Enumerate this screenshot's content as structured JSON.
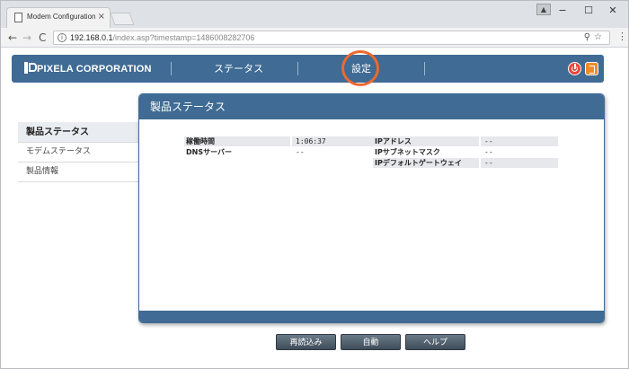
{
  "browser": {
    "tab_title": "Modem Configuration In",
    "tab_close": "×",
    "url_host": "192.168.0.1",
    "url_path": "/index.asp?timestamp=1486008282706",
    "nav_back": "←",
    "nav_forward": "→",
    "nav_reload": "C",
    "info": "i",
    "omni_icons": "⚲☆",
    "menu": "⋮",
    "minimize": "−",
    "maximize": "☐",
    "close": "✕",
    "profile": "▲"
  },
  "header": {
    "logo_text": "PIXELA CORPORATION",
    "nav_status": "ステータス",
    "nav_settings": "設定"
  },
  "sidebar": {
    "items": [
      {
        "label": "製品ステータス"
      },
      {
        "label": "モデムステータス"
      },
      {
        "label": "製品情報"
      }
    ]
  },
  "panel": {
    "title": "製品ステータス",
    "rows_left": [
      {
        "label": "稼働時間",
        "value": "1:06:37"
      },
      {
        "label": "DNSサーバー",
        "value": "--"
      }
    ],
    "rows_right": [
      {
        "label": "IPアドレス",
        "value": "--"
      },
      {
        "label": "IPサブネットマスク",
        "value": "--"
      },
      {
        "label": "IPデフォルトゲートウェイ",
        "value": "--"
      }
    ]
  },
  "buttons": {
    "reload": "再読込み",
    "auto": "自動",
    "help": "ヘルプ"
  },
  "colors": {
    "brand": "#3f6b94",
    "highlight": "#ea6a2f",
    "power": "#e7473b",
    "logout": "#ee8b2b"
  }
}
